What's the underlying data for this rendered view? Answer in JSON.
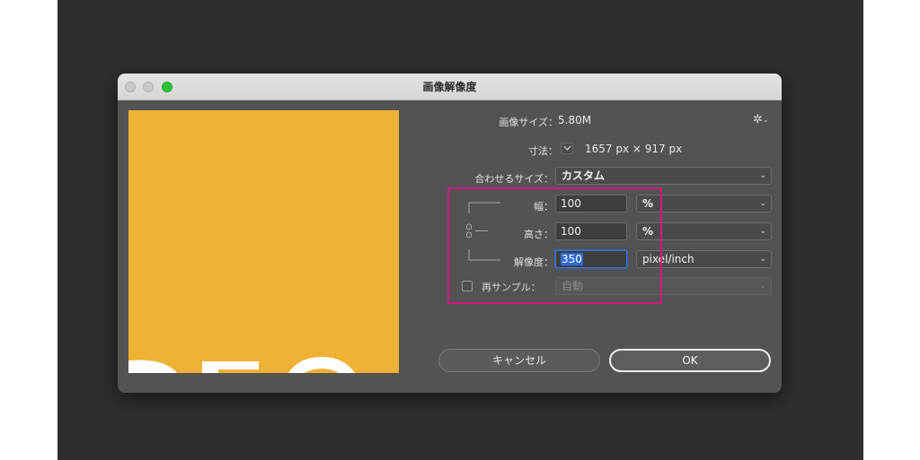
{
  "dialog": {
    "title": "画像解像度",
    "image_size_label": "画像サイズ：",
    "image_size_value": "5.80M",
    "dimensions_label": "寸法：",
    "dimensions_value": "1657 px × 917 px",
    "fit_label": "合わせるサイズ：",
    "fit_value": "カスタム",
    "width_label": "幅：",
    "width_value": "100",
    "width_unit": "%",
    "height_label": "高さ：",
    "height_value": "100",
    "height_unit": "%",
    "resolution_label": "解像度：",
    "resolution_value": "350",
    "resolution_unit": "pixel/inch",
    "resample_label": "再サンプル：",
    "resample_value": "自動",
    "cancel_label": "キャンセル",
    "ok_label": "OK"
  },
  "icons": {
    "settings": "gear-icon",
    "dropdown": "chevron-down-icon",
    "link": "chain-link-icon"
  },
  "colors": {
    "preview_background": "#efb234",
    "highlight_border": "#d0197e",
    "zoom_button": "#2cc133",
    "selection": "#2f6bd3"
  }
}
